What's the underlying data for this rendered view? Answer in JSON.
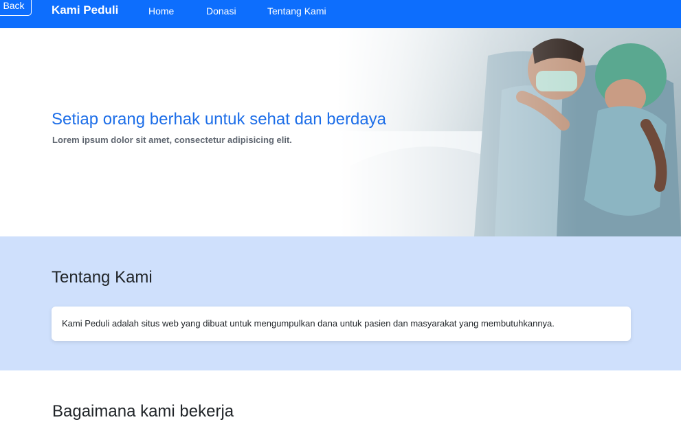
{
  "nav": {
    "back_label": "Back",
    "brand": "Kami Peduli",
    "links": [
      {
        "label": "Home"
      },
      {
        "label": "Donasi"
      },
      {
        "label": "Tentang Kami"
      }
    ],
    "bg_color": "#0d6efd"
  },
  "hero": {
    "title": "Setiap orang berhak untuk sehat dan berdaya",
    "subtitle": "Lorem ipsum dolor sit amet, consectetur adipisicing elit.",
    "title_color": "#1d6ee8"
  },
  "about": {
    "title": "Tentang Kami",
    "text": "Kami Peduli adalah situs web yang dibuat untuk mengumpulkan dana untuk pasien dan masyarakat yang membutuhkannya.",
    "bg_color": "#cfe0fc"
  },
  "how": {
    "title": "Bagaimana kami bekerja"
  }
}
